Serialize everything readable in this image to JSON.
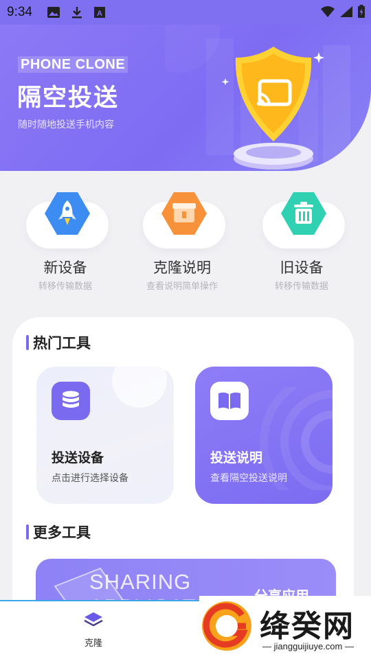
{
  "status_bar": {
    "time": "9:34",
    "icons_left": [
      "image-icon",
      "download-icon",
      "font-icon"
    ],
    "icons_right": [
      "wifi-icon",
      "signal-icon",
      "battery-icon"
    ]
  },
  "header": {
    "brand": "PHONE CLONE",
    "title": "隔空投送",
    "subtitle": "随时随地投送手机内容"
  },
  "actions": [
    {
      "label": "新设备",
      "sub": "转移传输数据",
      "icon": "rocket-icon",
      "color": "#3d8cf1"
    },
    {
      "label": "克隆说明",
      "sub": "查看说明简单操作",
      "icon": "box-icon",
      "color": "#f7923a"
    },
    {
      "label": "旧设备",
      "sub": "转移传输数据",
      "icon": "trash-icon",
      "color": "#2fd1b2"
    }
  ],
  "hot_tools": {
    "title": "热门工具",
    "cards": [
      {
        "title": "投送设备",
        "sub": "点击进行选择设备",
        "icon": "database-icon"
      },
      {
        "title": "投送说明",
        "sub": "查看隔空投送说明",
        "icon": "book-icon"
      }
    ]
  },
  "more_tools": {
    "title": "更多工具",
    "banner_text": "SHARING",
    "banner_text2": "APPLICATIO",
    "banner_label": "分享应用"
  },
  "bottom_nav": {
    "items": [
      {
        "label": "克隆",
        "icon": "layers-icon"
      }
    ]
  },
  "watermark": {
    "name": "绛癸网",
    "url": "jiangguijiuye.com"
  },
  "colors": {
    "accent": "#7a6af0",
    "header": "#8574f4"
  }
}
